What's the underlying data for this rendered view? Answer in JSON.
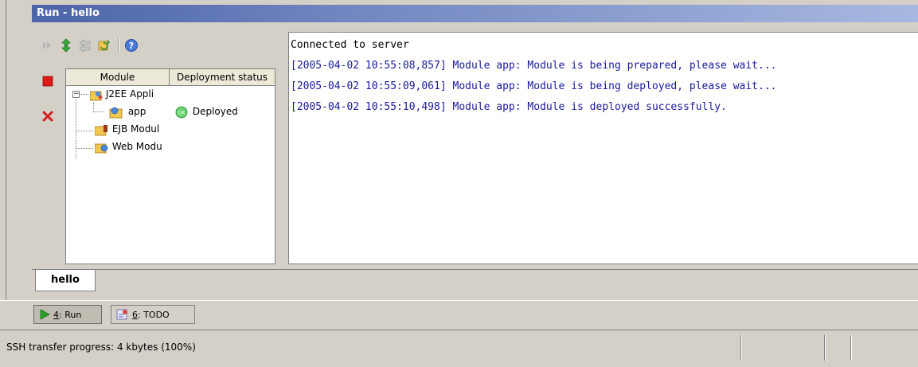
{
  "window": {
    "title": "Run - hello"
  },
  "toolbar": {
    "items": [
      {
        "name": "rerun-icon",
        "enabled": false
      },
      {
        "name": "deploy-icon",
        "enabled": true
      },
      {
        "name": "undeploy-icon",
        "enabled": false
      },
      {
        "name": "redeploy-icon",
        "enabled": true
      },
      {
        "name": "help-icon",
        "enabled": true
      }
    ],
    "side_buttons": [
      {
        "name": "stop-icon",
        "color": "#e01818"
      },
      {
        "name": "close-icon",
        "color": "#d02020"
      }
    ]
  },
  "tree": {
    "columns": [
      "Module",
      "Deployment status"
    ],
    "rows": [
      {
        "label": "J2EE Appli",
        "status": "",
        "icon": "j2ee-app-icon",
        "expanded": true
      },
      {
        "label": "app",
        "status": "Deployed",
        "icon": "app-module-icon",
        "status_icon": "ok-icon"
      },
      {
        "label": "EJB Modul",
        "status": "",
        "icon": "ejb-module-icon"
      },
      {
        "label": "Web Modu",
        "status": "",
        "icon": "web-module-icon"
      }
    ]
  },
  "console": {
    "lines": [
      {
        "text": "Connected to server",
        "color": "#000000"
      },
      {
        "text": "[2005-04-02 10:55:08,857] Module app: Module is being prepared, please wait...",
        "color": "#1a1a9c"
      },
      {
        "text": "[2005-04-02 10:55:09,061] Module app: Module is being deployed, please wait...",
        "color": "#1a1a9c"
      },
      {
        "text": "[2005-04-02 10:55:10,498] Module app: Module is deployed successfully.",
        "color": "#1a1a9c"
      }
    ]
  },
  "tabs": [
    {
      "label": "hello",
      "active": true
    }
  ],
  "tool_windows": [
    {
      "num": "4",
      "label": "Run",
      "icon": "run-icon",
      "active": true
    },
    {
      "num": "6",
      "label": "TODO",
      "icon": "todo-icon",
      "active": false
    }
  ],
  "status": {
    "text": "SSH transfer progress: 4 kbytes (100%)"
  },
  "colors": {
    "title_bar": "#5068b0",
    "console_text": "#1a1a9c"
  }
}
